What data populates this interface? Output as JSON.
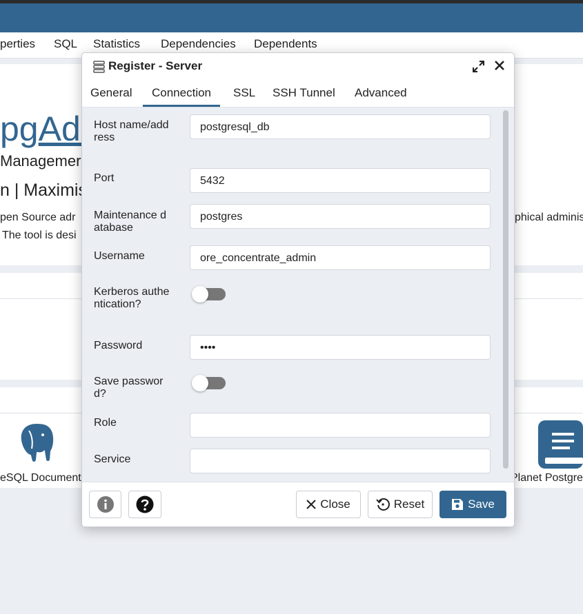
{
  "background": {
    "tabs": [
      "perties",
      "SQL",
      "Statistics",
      "Dependencies",
      "Dependents"
    ],
    "title_prefix": "pg",
    "title_link": "Adr",
    "subtitle": "Managemer",
    "subtitle2": "n | Maximis",
    "desc_left": "pen Source adr",
    "desc_right": "phical adminis",
    "desc_line2": "The tool is desi",
    "link_left": "eSQL Document",
    "link_right": "Planet Postgre"
  },
  "dialog": {
    "title": "Register - Server",
    "tabs": [
      "General",
      "Connection",
      "SSL",
      "SSH Tunnel",
      "Advanced"
    ],
    "active_tab": "Connection",
    "fields": {
      "host": {
        "label": "Host name/address",
        "value": "postgresql_db"
      },
      "port": {
        "label": "Port",
        "value": "5432"
      },
      "maintenance_db": {
        "label": "Maintenance database",
        "value": "postgres"
      },
      "username": {
        "label": "Username",
        "value": "ore_concentrate_admin"
      },
      "kerberos": {
        "label": "Kerberos authentication?",
        "state": "off"
      },
      "password": {
        "label": "Password",
        "value": "••••"
      },
      "save_password": {
        "label": "Save password?",
        "state": "off"
      },
      "role": {
        "label": "Role",
        "value": ""
      },
      "service": {
        "label": "Service",
        "value": ""
      }
    },
    "buttons": {
      "close": "Close",
      "reset": "Reset",
      "save": "Save"
    }
  },
  "colors": {
    "accent": "#326690",
    "dialog_body": "#ebeef3"
  }
}
